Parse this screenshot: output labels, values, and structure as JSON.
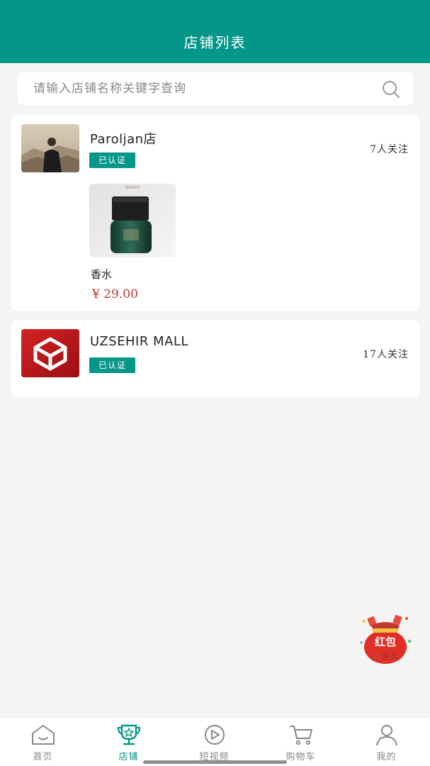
{
  "header": {
    "title": "店铺列表"
  },
  "search": {
    "placeholder": "请输入店铺名称关键字查询"
  },
  "shops": [
    {
      "name": "Paroljan店",
      "badge": "已认证",
      "followers": "7人关注",
      "products": [
        {
          "name": "香水",
          "price": "¥ 29.00",
          "brand_text": "AKKSIYA"
        }
      ]
    },
    {
      "name": "UZSEHIR MALL",
      "badge": "已认证",
      "followers": "17人关注"
    }
  ],
  "promo": {
    "line1": "红包",
    "line2": "大派送"
  },
  "tabbar": {
    "items": [
      {
        "label": "首页",
        "icon": "home-icon"
      },
      {
        "label": "店铺",
        "icon": "shop-trophy-icon",
        "active": true
      },
      {
        "label": "短视频",
        "icon": "play-icon"
      },
      {
        "label": "购物车",
        "icon": "cart-icon"
      },
      {
        "label": "我的",
        "icon": "user-icon"
      }
    ]
  },
  "colors": {
    "primary": "#05968a",
    "price": "#c0392b",
    "background": "#f4f4f4"
  }
}
